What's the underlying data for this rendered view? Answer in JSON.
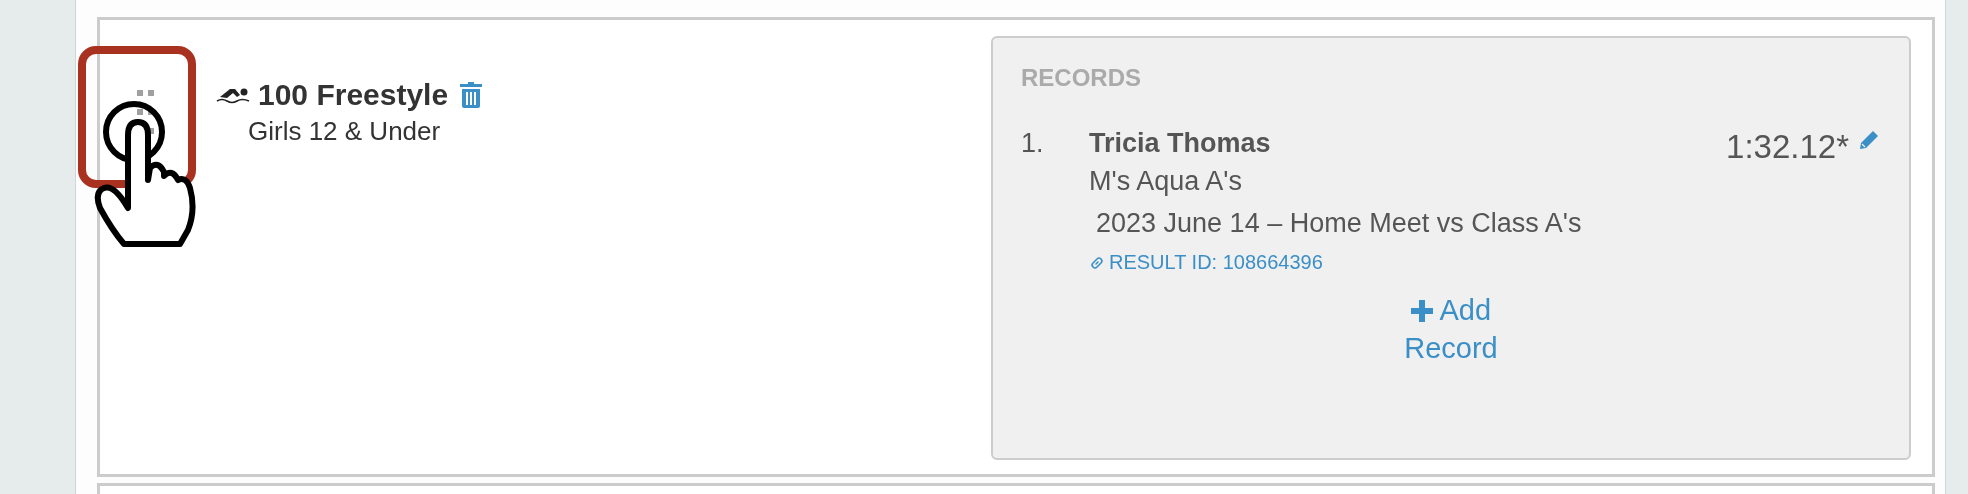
{
  "event": {
    "title": "100 Freestyle",
    "subtitle": "Girls 12 & Under"
  },
  "records_panel": {
    "heading": "RECORDS",
    "records": [
      {
        "rank": "1.",
        "name": "Tricia Thomas",
        "team": "M's Aqua A's",
        "meet": "2023 June 14 – Home Meet vs Class A's",
        "result_link": "RESULT ID: 108664396",
        "time": "1:32.12*"
      }
    ],
    "add_button": "Add Record"
  }
}
